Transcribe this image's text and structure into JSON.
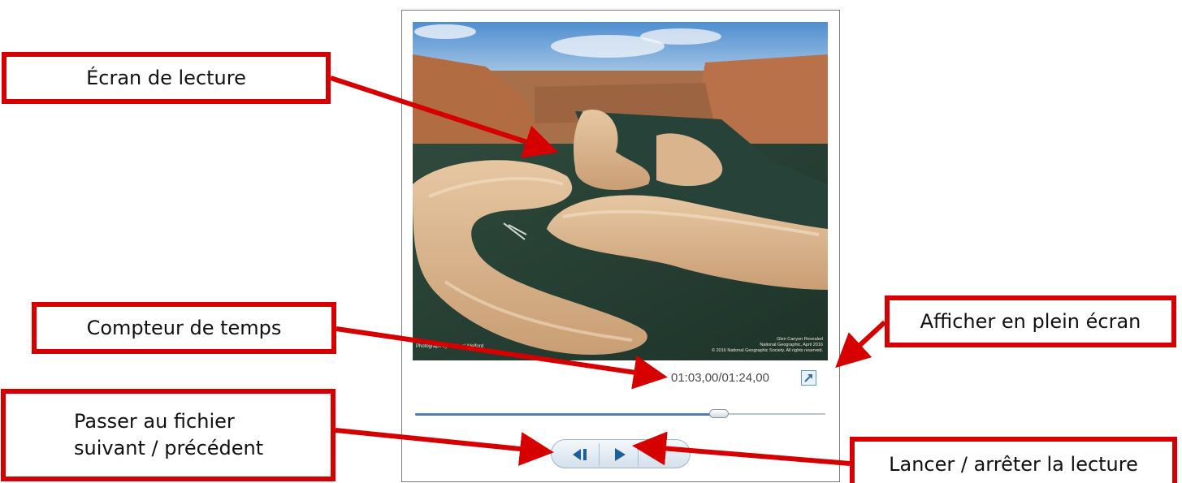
{
  "player": {
    "photo_credit": "Photograph by Michael Melford",
    "photo_caption_lines": [
      "Glen Canyon Revealed",
      "National Geographic, April 2016",
      "© 2016 National Geographic Society. All rights reserved."
    ],
    "timecode": "01:03,00/01:24,00",
    "playback_progress": 0.74,
    "buttons": {
      "previous": "previous-next-icon",
      "play": "play-icon",
      "stop": "stop-icon",
      "fullscreen": "fullscreen-icon"
    },
    "colors": {
      "progress": "#3a6ea6",
      "frame": "#7a7a7a"
    }
  },
  "callouts": {
    "screen": "Écran de lecture",
    "counter": "Compteur de temps",
    "fullscreen": "Afficher en plein écran",
    "nav_line1": "Passer au fichier",
    "nav_line2": "suivant / précédent",
    "playback": "Lancer / arrêter la lecture"
  },
  "colors": {
    "callout_border": "#d60000",
    "arrow": "#d60000"
  }
}
